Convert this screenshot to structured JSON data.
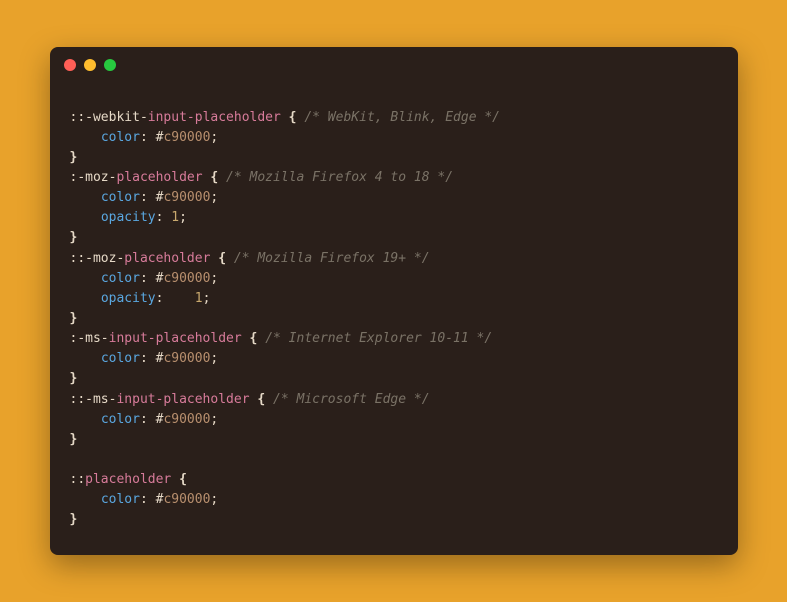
{
  "colors": {
    "background": "#e8a22b",
    "window": "#2a1f1a",
    "dot_red": "#ff5f56",
    "dot_yellow": "#ffbd2e",
    "dot_green": "#27c93f"
  },
  "code": {
    "blocks": [
      {
        "selector_prefix": "::-webkit-",
        "selector_highlight": "input-placeholder",
        "comment": "/* WebKit, Blink, Edge */",
        "props": [
          {
            "name": "color",
            "value_hash": "#",
            "value_hex": "c90000"
          }
        ]
      },
      {
        "selector_prefix": ":-moz-",
        "selector_highlight": "placeholder",
        "comment": "/* Mozilla Firefox 4 to 18 */",
        "props": [
          {
            "name": "color",
            "value_hash": "#",
            "value_hex": "c90000"
          },
          {
            "name": "opacity",
            "value_num": "1"
          }
        ]
      },
      {
        "selector_prefix": "::-moz-",
        "selector_highlight": "placeholder",
        "comment": "/* Mozilla Firefox 19+ */",
        "props": [
          {
            "name": "color",
            "value_hash": "#",
            "value_hex": "c90000"
          },
          {
            "name": "opacity",
            "value_num_spaced": "   1"
          }
        ]
      },
      {
        "selector_prefix": ":-ms-",
        "selector_highlight": "input-placeholder",
        "comment": "/* Internet Explorer 10-11 */",
        "props": [
          {
            "name": "color",
            "value_hash": "#",
            "value_hex": "c90000"
          }
        ]
      },
      {
        "selector_prefix": "::-ms-",
        "selector_highlight": "input-placeholder",
        "comment": "/* Microsoft Edge */",
        "props": [
          {
            "name": "color",
            "value_hash": "#",
            "value_hex": "c90000"
          }
        ]
      },
      {
        "selector_prefix": "::",
        "selector_highlight": "placeholder",
        "comment": "",
        "props": [
          {
            "name": "color",
            "value_hash": "#",
            "value_hex": "c90000"
          }
        ],
        "gap_before": true
      }
    ]
  }
}
